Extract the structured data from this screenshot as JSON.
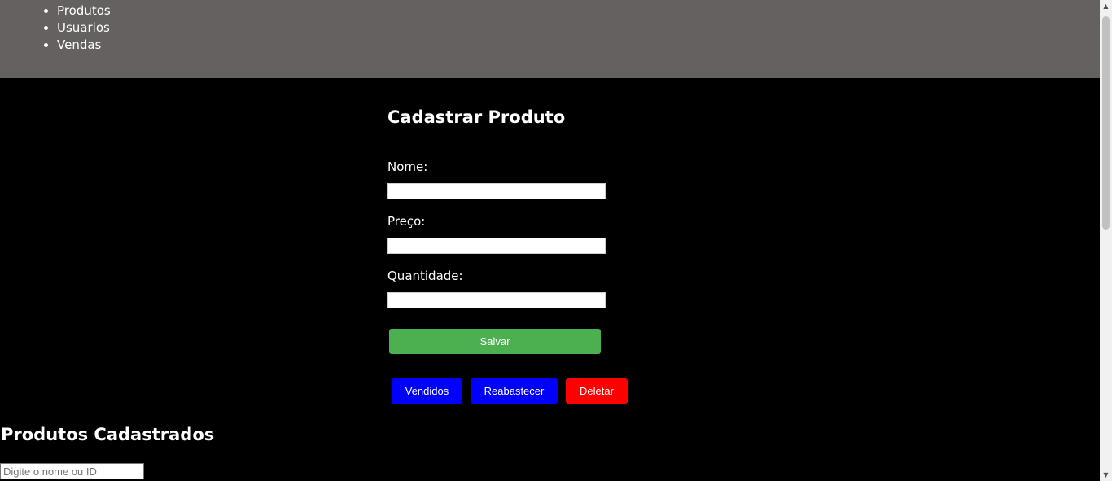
{
  "nav": {
    "items": [
      {
        "label": "Produtos"
      },
      {
        "label": "Usuarios"
      },
      {
        "label": "Vendas"
      }
    ]
  },
  "form": {
    "title": "Cadastrar Produto",
    "fields": {
      "nome": {
        "label": "Nome:",
        "value": ""
      },
      "preco": {
        "label": "Preço:",
        "value": ""
      },
      "quantidade": {
        "label": "Quantidade:",
        "value": ""
      }
    },
    "save_label": "Salvar"
  },
  "actions": {
    "vendidos_label": "Vendidos",
    "reabastecer_label": "Reabastecer",
    "deletar_label": "Deletar"
  },
  "list": {
    "title": "Produtos Cadastrados",
    "search": {
      "placeholder": "Digite o nome ou ID",
      "value": ""
    }
  },
  "colors": {
    "topbar": "#646160",
    "background": "#000000",
    "save_button": "#4caf50",
    "blue_button": "#0000ff",
    "delete_button": "#ff0000"
  },
  "icons": {
    "scroll_up": "chevron-up-icon",
    "scroll_down": "chevron-down-icon"
  }
}
